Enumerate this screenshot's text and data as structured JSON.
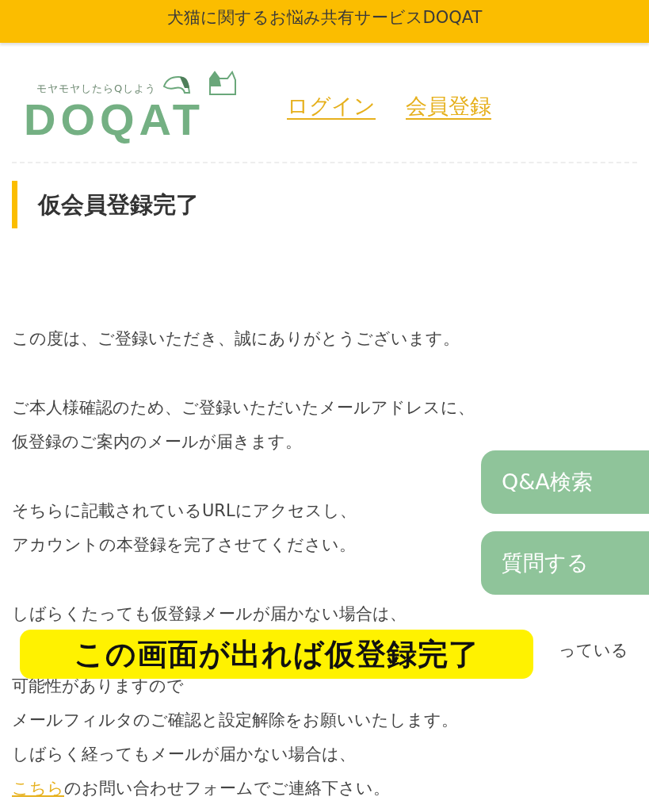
{
  "banner": {
    "text": "犬猫に関するお悩み共有サービスDOQAT"
  },
  "logo": {
    "tagline": "モヤモヤしたらQしよう",
    "wordmark": "DOQAT"
  },
  "nav": [
    {
      "label": "ログイン"
    },
    {
      "label": "会員登録"
    }
  ],
  "heading": "仮会員登録完了",
  "paragraphs": [
    [
      {
        "kind": "text",
        "text": "この度は、ご登録いただき、誠にありがとうございます。"
      }
    ],
    [
      {
        "kind": "text",
        "text": "ご本人様確認のため、ご登録いただいたメールアドレスに、"
      },
      {
        "kind": "text",
        "text": "仮登録のご案内のメールが届きます。"
      }
    ],
    [
      {
        "kind": "text",
        "text": "そちらに記載されているURLにアクセスし、"
      },
      {
        "kind": "text",
        "text": "アカウントの本登録を完了させてください。"
      }
    ],
    [
      {
        "kind": "text",
        "text": "しばらくたっても仮登録メールが届かない場合は、"
      },
      {
        "kind": "covered",
        "text": "っている"
      },
      {
        "kind": "text",
        "text": "可能性がありますので"
      },
      {
        "kind": "text",
        "text": "メールフィルタのご確認と設定解除をお願いいたします。"
      },
      {
        "kind": "text",
        "text": "しばらく経ってもメールが届かない場合は、"
      },
      {
        "kind": "link",
        "link": "こちら",
        "text": "のお問い合わせフォームでご連絡下さい。"
      }
    ]
  ],
  "floating_buttons": [
    {
      "label": "Q&A検索"
    },
    {
      "label": "質問する"
    }
  ],
  "annotation": "この画面が出れば仮登録完了"
}
